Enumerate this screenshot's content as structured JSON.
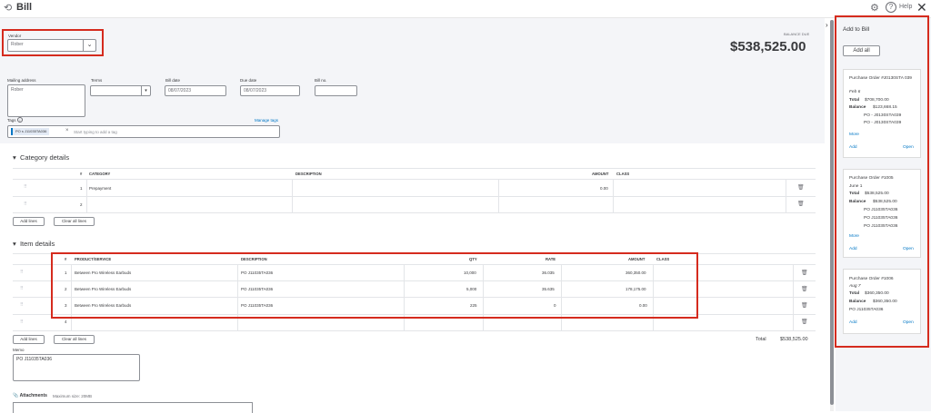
{
  "topbar": {
    "title": "Bill",
    "help_label": "Help",
    "history_icon": "history-icon",
    "gear_icon": "gear-icon",
    "close_icon": "close-icon"
  },
  "vendor": {
    "label": "Vendor",
    "value": "Rober"
  },
  "balance": {
    "label": "BALANCE DUE",
    "amount": "$538,525.00"
  },
  "mailing": {
    "label": "Mailing address",
    "value": "Rober"
  },
  "terms": {
    "label": "Terms",
    "value": ""
  },
  "bill_date": {
    "label": "Bill date",
    "value": "08/07/2023"
  },
  "due_date": {
    "label": "Due date",
    "value": "08/07/2023"
  },
  "bill_no": {
    "label": "Bill no.",
    "value": ""
  },
  "tags": {
    "label": "Tags",
    "manage": "Manage tags",
    "chip": "PO s J11035TA036",
    "placeholder": "Start typing to add a tag"
  },
  "category": {
    "title": "Category details",
    "headers": {
      "num": "#",
      "category": "CATEGORY",
      "description": "DESCRIPTION",
      "amount": "AMOUNT",
      "class": "CLASS"
    },
    "rows": [
      {
        "num": "1",
        "category": "Prepayment",
        "description": "",
        "amount": "0.00"
      },
      {
        "num": "2",
        "category": "",
        "description": "",
        "amount": ""
      }
    ],
    "add_lines": "Add lines",
    "clear_lines": "Clear all lines"
  },
  "items": {
    "title": "Item details",
    "headers": {
      "num": "#",
      "product": "PRODUCT/SERVICE",
      "description": "DESCRIPTION",
      "qty": "QTY",
      "rate": "RATE",
      "amount": "AMOUNT",
      "class": "CLASS"
    },
    "rows": [
      {
        "num": "1",
        "product": "Between Pro Wireless Earbuds",
        "description": "PO J11035TA036",
        "qty": "10,000",
        "rate": "36.035",
        "amount": "360,350.00"
      },
      {
        "num": "2",
        "product": "Between Pro Wireless Earbuds",
        "description": "PO J11035TA036",
        "qty": "5,000",
        "rate": "35.635",
        "amount": "178,175.00"
      },
      {
        "num": "3",
        "product": "Between Pro Wireless Earbuds",
        "description": "PO J11035TA036",
        "qty": "225",
        "rate": "0",
        "amount": "0.00"
      },
      {
        "num": "4",
        "product": "",
        "description": "",
        "qty": "",
        "rate": "",
        "amount": ""
      }
    ],
    "add_lines": "Add lines",
    "clear_lines": "Clear all lines",
    "total_label": "Total",
    "total_value": "$538,525.00"
  },
  "memo": {
    "label": "Memo",
    "value": "PO J11035TA036"
  },
  "attachments": {
    "label": "Attachments",
    "max": "Maximum size: 20MB"
  },
  "sidebar": {
    "title": "Add to Bill",
    "add_all": "Add all",
    "cards": [
      {
        "title": "Purchase Order #J0130STA 039",
        "date": "Feb 6",
        "total_label": "Total",
        "total": "$708,700.00",
        "balance_label": "Balance",
        "balance": "$123,668.15",
        "lines": [
          "PO - J0130STA039",
          "PO - J0130STA039"
        ],
        "more": "More",
        "add": "Add",
        "open": "Open"
      },
      {
        "title": "Purchase Order #1005",
        "date": "June 1",
        "total_label": "Total",
        "total": "$538,525.00",
        "balance_label": "Balance",
        "balance": "$538,525.00",
        "lines": [
          "PO J11035TA036",
          "PO J11035TA036",
          "PO J11035TA036"
        ],
        "more": "More",
        "add": "Add",
        "open": "Open"
      },
      {
        "title": "Purchase Order #1006",
        "date": "Aug 7",
        "total_label": "Total",
        "total": "$360,350.00",
        "balance_label": "Balance",
        "balance": "$360,350.00",
        "lines": [
          "PO J11035TA036"
        ],
        "more": "",
        "add": "Add",
        "open": "Open"
      }
    ]
  },
  "colors": {
    "highlight": "#d52b1e",
    "link": "#0077c5",
    "header_bg": "#f4f5f8"
  }
}
